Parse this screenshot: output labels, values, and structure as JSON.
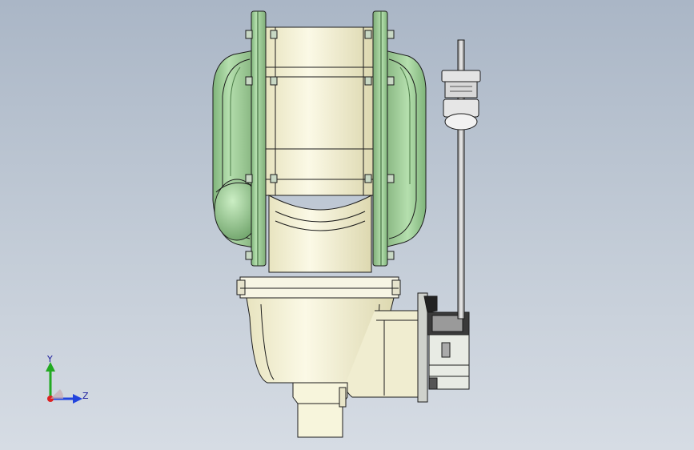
{
  "viewport": {
    "background_top": "#aab6c6",
    "background_bottom": "#d6dce4"
  },
  "model": {
    "flange_color": "#9ecf98",
    "housing_color": "#f4f1da",
    "body_color": "#fbfbef",
    "edge_color": "#1c1c1c",
    "actuator_color": "#d7d9d6"
  },
  "triad": {
    "y_label": "Y",
    "z_label": "Z",
    "y_color": "#22aa22",
    "z_color": "#2244dd",
    "x_color": "#dd2222"
  }
}
